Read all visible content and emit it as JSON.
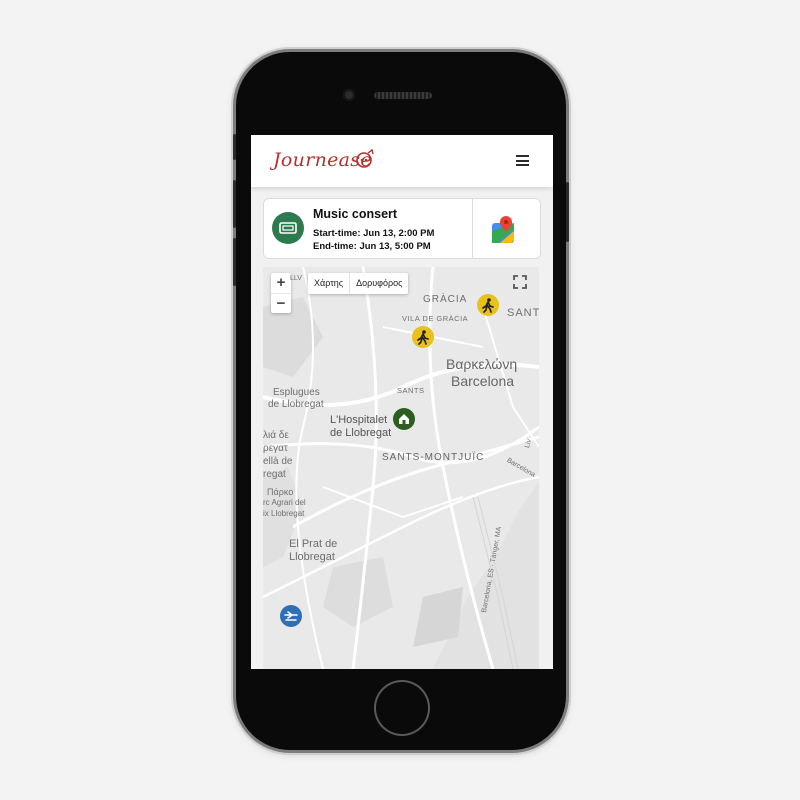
{
  "app": {
    "brand": "Journease"
  },
  "event": {
    "title": "Music consert",
    "start_time": "Start-time: Jun 13, 2:00 PM",
    "end_time": "End-time: Jun 13, 5:00 PM"
  },
  "map": {
    "zoom_in": "+",
    "zoom_out": "−",
    "map_type_map": "Χάρτης",
    "map_type_satellite": "Δορυφόρος",
    "labels": {
      "lleida_partial": "LLV",
      "gracia": "GRÀCIA",
      "sant_partial": "SANT",
      "vila_de_gracia": "VILA DE GRÀCIA",
      "barcelona_greek": "Βαρκελώνη",
      "barcelona": "Barcelona",
      "sants": "SANTS",
      "esplugues_1": "Esplugues",
      "esplugues_2": "de Llobregat",
      "hospitalet_1": "L'Hospitalet",
      "hospitalet_2": "de Llobregat",
      "cornella_1": "λιά δε",
      "cornella_2": "ρεγατ",
      "cornella_3": "ellà de",
      "cornella_4": "regat",
      "sants_montjuic": "SANTS-MONTJUÏC",
      "parc_1": "Πάρκο",
      "parc_2": "rc Agrari del",
      "parc_3": "ix Llobregat",
      "prat_1": "El Prat de",
      "prat_2": "Llobregat",
      "road_liv": "Liv",
      "road_barcelona": "Barcelona",
      "road_b10": "Barcelona, ES · Tànger, MA"
    },
    "markers": [
      {
        "name": "walk-marker-gracia",
        "icon": "walking-person-icon",
        "color": "#e8c21a"
      },
      {
        "name": "walk-marker-vila",
        "icon": "walking-person-icon",
        "color": "#e8c21a"
      },
      {
        "name": "home-marker",
        "icon": "home-icon",
        "color": "#2d5e1f"
      },
      {
        "name": "airport-marker",
        "icon": "airplane-icon",
        "color": "#2e6fb5"
      }
    ]
  },
  "colors": {
    "brand": "#b5322c",
    "ticket": "#2e7a4f",
    "walk_marker": "#e8c21a",
    "home_marker": "#2d5e1f",
    "airport_marker": "#2e6fb5"
  }
}
